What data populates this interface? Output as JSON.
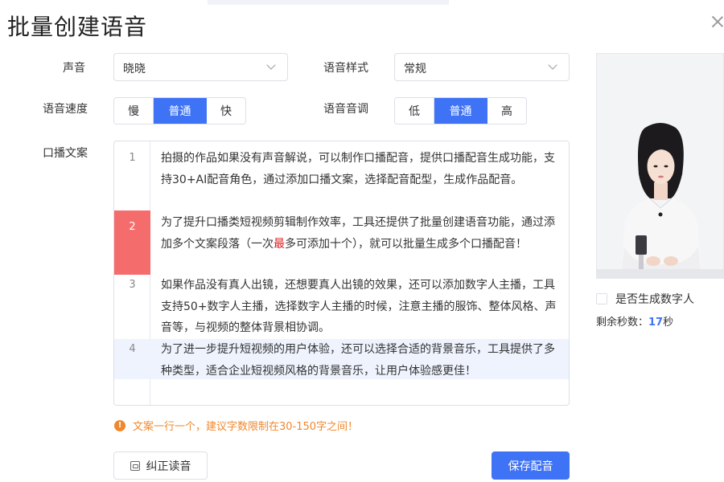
{
  "dialog": {
    "title": "批量创建语音"
  },
  "voice": {
    "label": "声音",
    "value": "晓晓"
  },
  "style": {
    "label": "语音样式",
    "value": "常规"
  },
  "speed": {
    "label": "语音速度",
    "options": [
      "慢",
      "普通",
      "快"
    ],
    "selected": "普通"
  },
  "pitch": {
    "label": "语音音调",
    "options": [
      "低",
      "普通",
      "高"
    ],
    "selected": "普通"
  },
  "script": {
    "label": "口播文案",
    "lines": [
      {
        "num": "1",
        "text": "拍摄的作品如果没有声音解说，可以制作口播配音，提供口播配音生成功能，支持30+AI配音角色，通过添加口播文案，选择配音配型，生成作品配音。"
      },
      {
        "num": "2",
        "text_before": "为了提升口播类短视频剪辑制作效率，工具还提供了批量创建语音功能，通过添加多个文案段落（一次",
        "text_red": "最",
        "text_after": "多可添加十个），就可以批量生成多个口播配音！"
      },
      {
        "num": "3",
        "text": "如果作品没有真人出镜，还想要真人出镜的效果，还可以添加数字人主播，工具支持50+数字人主播，选择数字人主播的时候，注意主播的服饰、整体风格、声音等，与视频的整体背景相协调。"
      },
      {
        "num": "4",
        "text": "为了进一步提升短视频的用户体验，还可以选择合适的背景音乐，工具提供了多种类型，适合企业短视频风格的背景音乐，让用户体验感更佳！"
      }
    ]
  },
  "tip": {
    "text": "文案一行一个，建议字数限制在30-150字之间！"
  },
  "buttons": {
    "fix": "纠正读音",
    "save": "保存配音"
  },
  "avatar": {
    "checkbox_label": "是否生成数字人",
    "remaining_label": "剩余秒数：",
    "remaining_value": "17",
    "remaining_unit": "秒"
  },
  "colors": {
    "primary": "#3f73f6",
    "error_row": "#f56c6c",
    "warning": "#f0882d",
    "highlight_row": "#eef3fd"
  }
}
